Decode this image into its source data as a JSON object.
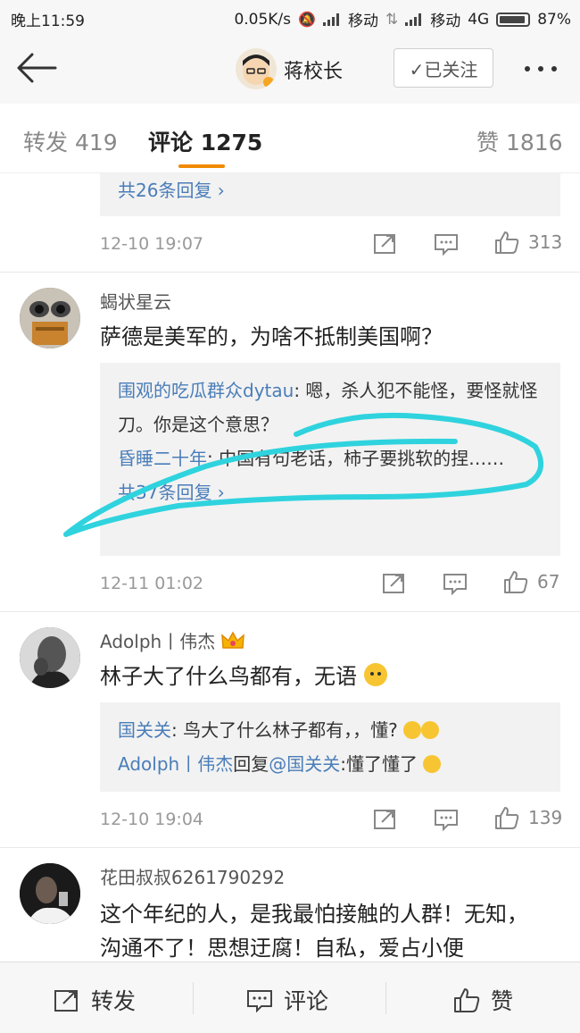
{
  "status": {
    "time": "晚上11:59",
    "speed": "0.05K/s",
    "carrier1": "移动",
    "carrier2": "移动",
    "network": "4G",
    "battery": "87%"
  },
  "header": {
    "title": "蒋校长",
    "follow_label": "✓已关注"
  },
  "tabs": {
    "repost": "转发 419",
    "comment": "评论 1275",
    "like": "赞 1816"
  },
  "comments": [
    {
      "more_replies": "共26条回复 ›",
      "time": "12-10 19:07",
      "likes": "313"
    },
    {
      "user": "蝎状星云",
      "text": "萨德是美军的，为啥不抵制美国啊？",
      "replies": [
        {
          "user": "围观的吃瓜群众dytau",
          "text": ": 嗯，杀人犯不能怪，要怪就怪刀。你是这个意思？"
        },
        {
          "user": "昏睡二十年",
          "text": ": 中国有句老话，柿子要挑软的捏……"
        }
      ],
      "more_replies": "共37条回复 ›",
      "time": "12-11 01:02",
      "likes": "67"
    },
    {
      "user": "Adolph丨伟杰",
      "text": "林子大了什么鸟都有，无语",
      "replies": [
        {
          "user": "国关关",
          "text": ": 鸟大了什么林子都有，，懂?"
        },
        {
          "user": "Adolph丨伟杰",
          "mid": "回复",
          "mention": "@国关关",
          "text": ":懂了懂了"
        }
      ],
      "time": "12-10 19:04",
      "likes": "139"
    },
    {
      "user": "花田叔叔6261790292",
      "text": "这个年纪的人，是我最怕接触的人群！无知，沟通不了！思想迂腐！自私，爱占小便"
    }
  ],
  "bottom": {
    "repost": "转发",
    "comment": "评论",
    "like": "赞"
  },
  "colors": {
    "link_blue": "#4a7db8",
    "orange": "#e8720c",
    "accent_underline": "#f08a00",
    "annotation_cyan": "#2fd3de"
  }
}
